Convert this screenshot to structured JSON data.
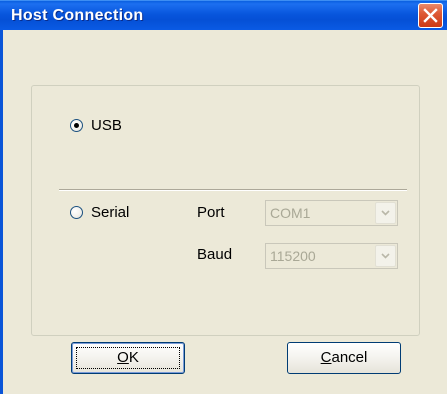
{
  "window": {
    "title": "Host Connection",
    "close_icon": "close-icon"
  },
  "connection": {
    "usb_label": "USB",
    "usb_selected": true,
    "serial_label": "Serial",
    "serial_selected": false,
    "port_label": "Port",
    "port_value": "COM1",
    "port_enabled": false,
    "baud_label": "Baud",
    "baud_value": "115200",
    "baud_enabled": false
  },
  "buttons": {
    "ok_label_mnemonic": "O",
    "ok_label_rest": "K",
    "cancel_label_mnemonic": "C",
    "cancel_label_rest": "ancel"
  },
  "colors": {
    "titlebar": "#0856dd",
    "face": "#ece9d8",
    "close_button": "#de5a36",
    "disabled_text": "#a9a896"
  }
}
